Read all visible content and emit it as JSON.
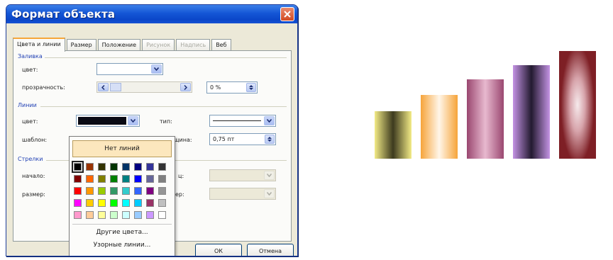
{
  "window": {
    "title": "Формат объекта"
  },
  "tabs": [
    {
      "label": "Цвета и линии",
      "active": true,
      "enabled": true
    },
    {
      "label": "Размер",
      "active": false,
      "enabled": true
    },
    {
      "label": "Положение",
      "active": false,
      "enabled": true
    },
    {
      "label": "Рисунок",
      "active": false,
      "enabled": false
    },
    {
      "label": "Надпись",
      "active": false,
      "enabled": false
    },
    {
      "label": "Веб",
      "active": false,
      "enabled": true
    }
  ],
  "fill": {
    "group_title": "Заливка",
    "color_label": "цвет:",
    "transparency_label": "прозрачность:",
    "transparency_value": "0 %"
  },
  "lines": {
    "group_title": "Линии",
    "color_label": "цвет:",
    "pattern_label": "шаблон:",
    "type_label": "тип:",
    "weight_label_partial": "щина:",
    "weight_value": "0,75 пт",
    "color_value": "#0a0a14"
  },
  "arrows": {
    "group_title": "Стрелки",
    "begin_label": "начало:",
    "size_label": "размер:",
    "end_label_partial": "ц:",
    "size2_label_partial": "ер:"
  },
  "palette": {
    "no_lines_label": "Нет линий",
    "more_colors_label": "Другие цвета...",
    "patterned_lines_label": "Узорные линии...",
    "colors": [
      "#000000",
      "#993300",
      "#333300",
      "#003300",
      "#003366",
      "#000080",
      "#333399",
      "#333333",
      "#800000",
      "#ff6600",
      "#808000",
      "#008000",
      "#008080",
      "#0000ff",
      "#666699",
      "#808080",
      "#ff0000",
      "#ff9900",
      "#99cc00",
      "#339966",
      "#33cccc",
      "#3366ff",
      "#800080",
      "#969696",
      "#ff00ff",
      "#ffcc00",
      "#ffff00",
      "#00ff00",
      "#00ffff",
      "#00ccff",
      "#993366",
      "#c0c0c0",
      "#ff99cc",
      "#ffcc99",
      "#ffff99",
      "#ccffcc",
      "#ccffff",
      "#99ccff",
      "#cc99ff",
      "#ffffff"
    ]
  },
  "buttons": {
    "ok": "ОК",
    "cancel": "Отмена"
  },
  "gradient_bars": [
    {
      "light": "#f3eb86",
      "dark": "#3d3a1e",
      "value": 0.44
    },
    {
      "light": "#f6a43a",
      "dark": "#fff6e9",
      "value": 0.59
    },
    {
      "light": "#9a4770",
      "dark": "#e8b9cf",
      "value": 0.74
    },
    {
      "light": "#c493e4",
      "dark": "#231a30",
      "value": 0.87
    },
    {
      "light": "#7e1f25",
      "dark": "#f6eaec",
      "value": 1.0
    }
  ]
}
